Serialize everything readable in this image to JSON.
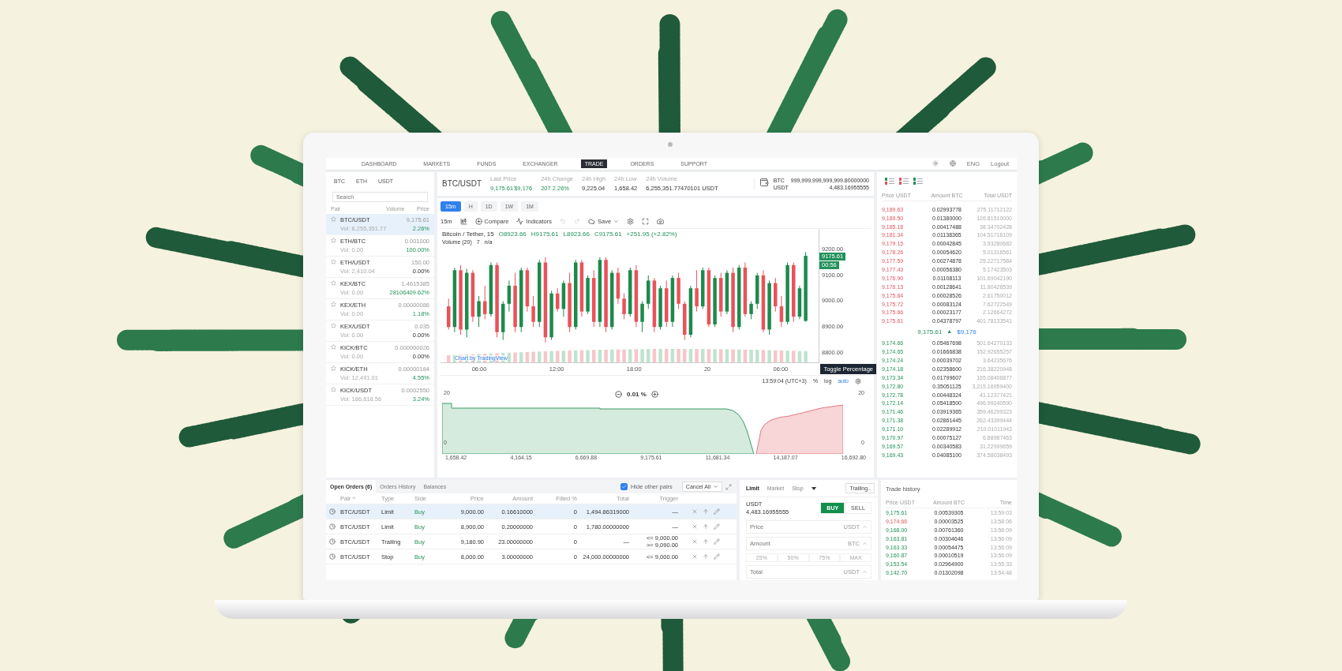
{
  "nav": {
    "items": [
      {
        "label": "DASHBOARD",
        "selected": false
      },
      {
        "label": "MARKETS",
        "selected": false
      },
      {
        "label": "FUNDS",
        "selected": false
      },
      {
        "label": "EXCHANGER",
        "selected": false
      },
      {
        "label": "TRADE",
        "selected": true
      },
      {
        "label": "ORDERS",
        "selected": false
      },
      {
        "label": "SUPPORT",
        "selected": false
      }
    ],
    "language": "ENG",
    "logout": "Logout"
  },
  "watchlist": {
    "tabs": [
      "BTC",
      "ETH",
      "USDT"
    ],
    "search": {
      "placeholder": "Search"
    },
    "columns": [
      "Pair",
      "Volume",
      "Price"
    ],
    "rows": [
      {
        "pair": "BTC/USDT",
        "volume": "Vol: 6,255,351.77",
        "price": "9,175.61",
        "change": "2.26%",
        "positive": true,
        "selected": true
      },
      {
        "pair": "ETH/BTC",
        "volume": "Vol: 0.00",
        "price": "0.001000",
        "change": "100.00%",
        "positive": true,
        "selected": false
      },
      {
        "pair": "ETH/USDT",
        "volume": "Vol: 2,410.04",
        "price": "150.00",
        "change": "0.00%",
        "positive": false,
        "selected": false
      },
      {
        "pair": "KEX/BTC",
        "volume": "Vol: 0.00",
        "price": "1.4615385",
        "change": "28106409.62%",
        "positive": true,
        "selected": false
      },
      {
        "pair": "KEX/ETH",
        "volume": "Vol: 0.00",
        "price": "0.00000086",
        "change": "1.18%",
        "positive": true,
        "selected": false
      },
      {
        "pair": "KEX/USDT",
        "volume": "Vol: 0.00",
        "price": "0.035",
        "change": "0.00%",
        "positive": false,
        "selected": false
      },
      {
        "pair": "KICK/BTC",
        "volume": "Vol: 0.00",
        "price": "0.000000026",
        "change": "0.00%",
        "positive": false,
        "selected": false
      },
      {
        "pair": "KICK/ETH",
        "volume": "Vol: 12,491.01",
        "price": "0.00000184",
        "change": "4.55%",
        "positive": true,
        "selected": false
      },
      {
        "pair": "KICK/USDT",
        "volume": "Vol: 186,618.56",
        "price": "0.0002550",
        "change": "3.24%",
        "positive": true,
        "selected": false
      }
    ]
  },
  "market": {
    "pair": "BTC/USDT",
    "stats": [
      {
        "label": "Last Price",
        "values": [
          "9,175.61",
          "$9,176"
        ]
      },
      {
        "label": "24h Change",
        "values": [
          "207 2.26%"
        ]
      },
      {
        "label": "24h High",
        "values": [
          "9,225.04"
        ]
      },
      {
        "label": "24h Low",
        "values": [
          "1,658.42"
        ]
      },
      {
        "label": "24h Volume",
        "values": [
          "6,255,351.77470101 USDT"
        ]
      }
    ],
    "balances": [
      {
        "currency": "BTC",
        "amount": "999,999,999,999,999.80000000"
      },
      {
        "currency": "USDT",
        "amount": "4,483.16955555"
      }
    ]
  },
  "chart": {
    "intervals": [
      {
        "label": "15m",
        "selected": true
      },
      {
        "label": "H",
        "selected": false
      },
      {
        "label": "1D",
        "selected": false
      },
      {
        "label": "1W",
        "selected": false
      },
      {
        "label": "1M",
        "selected": false
      }
    ],
    "toolbar": {
      "interval": "15m",
      "compare": "Compare",
      "indicators": "Indicators",
      "save": "Save"
    },
    "legend": {
      "title": "Bitcoin / Tether, 15",
      "ohlc": [
        {
          "key": "O",
          "value": "8923.66"
        },
        {
          "key": "H",
          "value": "9175.61"
        },
        {
          "key": "L",
          "value": "8923.66"
        },
        {
          "key": "C",
          "value": "9175.61"
        }
      ],
      "change": "+251.95 (+2.82%)",
      "volume_label": "Volume (20)",
      "volume_values": [
        "7",
        "n/a"
      ]
    },
    "chart_data": {
      "type": "candlestick",
      "ylim": [
        8760,
        9280
      ],
      "yticks": [
        {
          "value": 9200,
          "label": "9200.00"
        },
        {
          "value": 9100,
          "label": "9100.00"
        },
        {
          "value": 9000,
          "label": "9000.00"
        },
        {
          "value": 8900,
          "label": "8900.00"
        },
        {
          "value": 8800,
          "label": "8800.00"
        }
      ],
      "ohlc": [
        [
          8980,
          9010,
          8890,
          8900
        ],
        [
          8900,
          9130,
          8880,
          9120
        ],
        [
          9120,
          9140,
          8870,
          8890
        ],
        [
          8890,
          9125,
          8860,
          9110
        ],
        [
          9110,
          9120,
          8920,
          8940
        ],
        [
          8940,
          9020,
          8900,
          9000
        ],
        [
          9000,
          9060,
          8930,
          8950
        ],
        [
          8950,
          9150,
          8940,
          9140
        ],
        [
          9140,
          9150,
          8860,
          8880
        ],
        [
          8880,
          9000,
          8850,
          8990
        ],
        [
          8990,
          9080,
          8960,
          9060
        ],
        [
          9060,
          9110,
          8880,
          8900
        ],
        [
          8900,
          9130,
          8880,
          9120
        ],
        [
          9120,
          9130,
          8960,
          8980
        ],
        [
          8980,
          9020,
          8900,
          8920
        ],
        [
          8920,
          9160,
          8900,
          9150
        ],
        [
          9150,
          9170,
          8840,
          8860
        ],
        [
          8860,
          9040,
          8850,
          9030
        ],
        [
          9030,
          9050,
          8960,
          8970
        ],
        [
          8970,
          9080,
          8940,
          9070
        ],
        [
          9070,
          9110,
          8880,
          8900
        ],
        [
          8900,
          9160,
          8890,
          9150
        ],
        [
          9150,
          9160,
          8940,
          8960
        ],
        [
          8960,
          9100,
          8950,
          9090
        ],
        [
          9090,
          9120,
          8900,
          8920
        ],
        [
          8920,
          9170,
          8900,
          9160
        ],
        [
          9160,
          9170,
          8880,
          8900
        ],
        [
          8900,
          9120,
          8890,
          9110
        ],
        [
          9110,
          9130,
          8990,
          9010
        ],
        [
          9010,
          9030,
          8930,
          8950
        ],
        [
          8950,
          9130,
          8940,
          9120
        ],
        [
          9120,
          9140,
          8900,
          8920
        ],
        [
          8920,
          9000,
          8880,
          8990
        ],
        [
          8990,
          9100,
          8970,
          9080
        ],
        [
          9080,
          9090,
          8880,
          8900
        ],
        [
          8900,
          9060,
          8890,
          9050
        ],
        [
          9050,
          9080,
          8900,
          8920
        ],
        [
          8920,
          9100,
          8900,
          9090
        ],
        [
          9090,
          9110,
          8970,
          8990
        ],
        [
          8990,
          9000,
          8850,
          8870
        ],
        [
          8870,
          9060,
          8860,
          9050
        ],
        [
          9050,
          9120,
          8960,
          8980
        ],
        [
          8980,
          9130,
          8970,
          9120
        ],
        [
          9120,
          9130,
          8900,
          8910
        ],
        [
          8910,
          9100,
          8900,
          9090
        ],
        [
          9090,
          9110,
          8940,
          8960
        ],
        [
          8960,
          9120,
          8950,
          9110
        ],
        [
          9110,
          9130,
          8880,
          8900
        ],
        [
          8900,
          9140,
          8890,
          9130
        ],
        [
          9130,
          9150,
          8940,
          8950
        ],
        [
          8950,
          9000,
          8930,
          8990
        ],
        [
          8990,
          9110,
          8970,
          9100
        ],
        [
          9100,
          9120,
          8880,
          8890
        ],
        [
          8890,
          9080,
          8870,
          9070
        ],
        [
          9070,
          9090,
          8960,
          8980
        ],
        [
          8980,
          9020,
          8900,
          8920
        ],
        [
          8920,
          9150,
          8910,
          9140
        ],
        [
          9140,
          9150,
          8920,
          8940
        ],
        [
          8940,
          9060,
          8930,
          9050
        ],
        [
          8923.66,
          9190,
          8920,
          9175.61
        ]
      ]
    },
    "price_tag": "9175.61",
    "countdown": "00:56",
    "time_axis": [
      "06:00",
      "12:00",
      "18:00",
      "20",
      "06:00"
    ],
    "attribution": "Chart by TradingView",
    "tooltip": "Toggle Percentage",
    "footer": {
      "time": "13:59:04 (UTC+3)",
      "percent": "%",
      "log": "log",
      "auto": "auto"
    }
  },
  "depth": {
    "left_axis": [
      "20",
      "0"
    ],
    "right_axis": [
      "20",
      "0"
    ],
    "spread": "0.01 %",
    "x_axis": [
      "1,658.42",
      "4,164.15",
      "6,669.88",
      "9,175.61",
      "11,681.34",
      "14,187.07",
      "16,692.80"
    ]
  },
  "order_book": {
    "columns": [
      "Price USDT",
      "Amount BTC",
      "Total USDT"
    ],
    "asks": [
      [
        "9,189.63",
        "0.02993778",
        "275.11712122"
      ],
      [
        "9,189.50",
        "0.01380000",
        "126.81510000"
      ],
      [
        "9,185.18",
        "0.00417488",
        "38.34702428"
      ],
      [
        "9,181.34",
        "0.01138365",
        "104.51716109"
      ],
      [
        "9,179.15",
        "0.00042845",
        "3.93280682"
      ],
      [
        "9,178.26",
        "0.00054620",
        "5.01316561"
      ],
      [
        "9,177.59",
        "0.00274878",
        "25.22717584"
      ],
      [
        "9,177.43",
        "0.00056380",
        "5.17423503"
      ],
      [
        "9,176.90",
        "0.01108113",
        "101.69042190"
      ],
      [
        "9,176.13",
        "0.00128641",
        "11.80426539"
      ],
      [
        "9,175.84",
        "0.00028526",
        "2.61750012"
      ],
      [
        "9,175.72",
        "0.00083124",
        "7.62722549"
      ],
      [
        "9,175.66",
        "0.00023177",
        "2.12664272"
      ],
      [
        "9,175.61",
        "0.04378797",
        "401.78133541"
      ]
    ],
    "last": {
      "price": "9,175.61",
      "arrow": "▲",
      "usd": "$9,176"
    },
    "bids": [
      [
        "9,174.66",
        "0.05467698",
        "501.64270133"
      ],
      [
        "9,174.65",
        "0.01666838",
        "152.92655257"
      ],
      [
        "9,174.24",
        "0.00039702",
        "3.64235676"
      ],
      [
        "9,174.18",
        "0.02358600",
        "216.38220948"
      ],
      [
        "9,173.34",
        "0.01799607",
        "165.08406877"
      ],
      [
        "9,172.80",
        "0.35051125",
        "3,215.16959400"
      ],
      [
        "9,172.78",
        "0.00448324",
        "41.12377421"
      ],
      [
        "9,172.14",
        "0.05418500",
        "496.99240590"
      ],
      [
        "9,171.46",
        "0.03919365",
        "359.46299323"
      ],
      [
        "9,171.38",
        "0.02861445",
        "262.43399444"
      ],
      [
        "9,171.10",
        "0.02289912",
        "210.01011943"
      ],
      [
        "9,170.97",
        "0.00075127",
        "6.88987463"
      ],
      [
        "9,169.57",
        "0.00340583",
        "31.22999659"
      ],
      [
        "9,169.43",
        "0.04085100",
        "374.58038493"
      ]
    ]
  },
  "orders": {
    "tabs": [
      {
        "label": "Open Orders (6)",
        "selected": true
      },
      {
        "label": "Orders History",
        "selected": false
      },
      {
        "label": "Balances",
        "selected": false
      }
    ],
    "hide_other_pairs": {
      "label": "Hide other pairs",
      "checked": true
    },
    "cancel_all": "Cancel All",
    "columns": [
      "Pair ^",
      "Type",
      "Side",
      "Price",
      "Amount",
      "Filled %",
      "Total",
      "Trigger"
    ],
    "rows": [
      {
        "pair": "BTC/USDT",
        "type": "Limit",
        "side": "Buy",
        "price": "9,000.00",
        "amount": "0.16610000",
        "filled": "0",
        "total": "1,494.86319000",
        "trigger": [
          "—"
        ],
        "selected": true
      },
      {
        "pair": "BTC/USDT",
        "type": "Limit",
        "side": "Buy",
        "price": "8,900.00",
        "amount": "0.20000000",
        "filled": "0",
        "total": "1,780.00000000",
        "trigger": [
          "—"
        ],
        "selected": false
      },
      {
        "pair": "BTC/USDT",
        "type": "Trailing",
        "side": "Buy",
        "price": "9,180.90",
        "amount": "23.00000000",
        "filled": "0",
        "total": "—",
        "trigger": [
          "<= 9,000.00",
          ">= 9,090.00"
        ],
        "selected": false
      },
      {
        "pair": "BTC/USDT",
        "type": "Stop",
        "side": "Buy",
        "price": "8,000.00",
        "amount": "3.00000000",
        "filled": "0",
        "total": "24,000.00000000",
        "trigger": [
          "<= 9,000.00"
        ],
        "selected": false
      }
    ]
  },
  "order_form": {
    "tabs": [
      {
        "label": "Limit",
        "selected": true
      },
      {
        "label": "Market",
        "selected": false
      },
      {
        "label": "Stop",
        "selected": false
      }
    ],
    "trailing": "Trailing..",
    "balance_currency": "USDT",
    "balance": "4,483.16955555",
    "sides": [
      {
        "label": "BUY",
        "selected": true
      },
      {
        "label": "SELL",
        "selected": false
      }
    ],
    "fields": [
      {
        "placeholder": "Price",
        "unit": "USDT"
      },
      {
        "placeholder": "Amount",
        "unit": "BTC"
      }
    ],
    "percents": [
      "25%",
      "50%",
      "75%",
      "MAX"
    ],
    "total": {
      "placeholder": "Total",
      "unit": "USDT"
    }
  },
  "trade_history": {
    "title": "Trade history",
    "columns": [
      "Price USDT",
      "Amount BTC",
      "Time"
    ],
    "rows": [
      {
        "price": "9,175.61",
        "amount": "0.00539305",
        "time": "13:59:03",
        "sell": false
      },
      {
        "price": "9,174.66",
        "amount": "0.00003525",
        "time": "13:58:06",
        "sell": true
      },
      {
        "price": "9,168.00",
        "amount": "0.00761360",
        "time": "13:56:09",
        "sell": false
      },
      {
        "price": "9,163.81",
        "amount": "0.00304646",
        "time": "13:56:09",
        "sell": false
      },
      {
        "price": "9,163.33",
        "amount": "0.00054475",
        "time": "13:56:09",
        "sell": false
      },
      {
        "price": "9,160.87",
        "amount": "0.00010519",
        "time": "13:56:09",
        "sell": false
      },
      {
        "price": "9,153.54",
        "amount": "0.02964900",
        "time": "13:55:33",
        "sell": false
      },
      {
        "price": "9,142.70",
        "amount": "0.01302098",
        "time": "13:54:48",
        "sell": false
      }
    ]
  }
}
